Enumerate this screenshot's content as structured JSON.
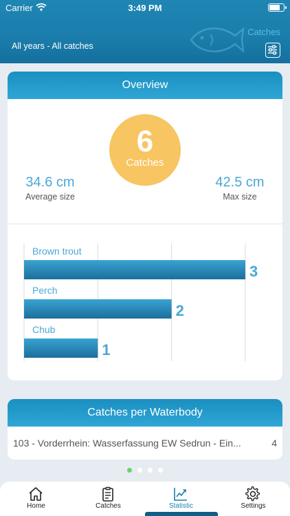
{
  "status_bar": {
    "carrier": "Carrier",
    "time": "3:49 PM"
  },
  "header": {
    "filter_label": "All years - All catches",
    "page_label": "Catches"
  },
  "overview": {
    "title": "Overview",
    "total_catches": "6",
    "total_label": "Catches",
    "average_size": "34.6 cm",
    "average_label": "Average size",
    "max_size": "42.5 cm",
    "max_label": "Max size"
  },
  "chart_data": {
    "type": "bar",
    "orientation": "horizontal",
    "categories": [
      "Brown trout",
      "Perch",
      "Chub"
    ],
    "values": [
      3,
      2,
      1
    ],
    "xlim": [
      0,
      3
    ],
    "grid": true,
    "colors": {
      "bar": "#2c8fbf",
      "label": "#4aa8d5",
      "value": "#4aa8d5"
    }
  },
  "waterbody": {
    "title": "Catches per Waterbody",
    "rows": [
      {
        "name": "103 - Vorderrhein: Wasserfassung EW Sedrun - Ein...",
        "count": "4"
      }
    ]
  },
  "pager": {
    "count": 4,
    "active": 0
  },
  "tabs": [
    {
      "label": "Home",
      "icon": "home-icon"
    },
    {
      "label": "Catches",
      "icon": "clipboard-icon"
    },
    {
      "label": "Statistic",
      "icon": "chart-icon"
    },
    {
      "label": "Settings",
      "icon": "gear-icon"
    }
  ],
  "colors": {
    "header": "#1b7eac",
    "accent": "#4aa8d5",
    "badge": "#f7c561",
    "active_dot": "#6fcf6f"
  }
}
